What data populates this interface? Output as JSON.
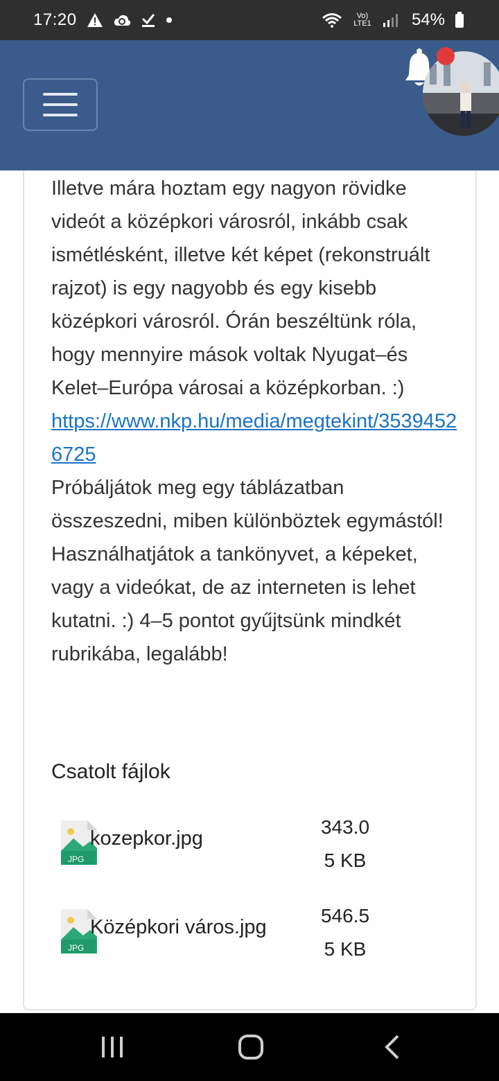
{
  "status_bar": {
    "time": "17:20",
    "left_icons": [
      "warning-icon",
      "cloud-sync-icon",
      "check-download-icon",
      "dot-icon"
    ],
    "network": "Vo) LTE1",
    "battery": "54%"
  },
  "app_header": {
    "menu_icon": "hamburger-icon",
    "notification_icon": "bell-icon",
    "profile_picture": "user-avatar"
  },
  "post": {
    "text_1": "Illetve mára hoztam egy nagyon rövidke videót a középkori városról, inkább csak ismétlésként, illetve két képet (rekonstruált rajzot) is egy nagyobb és egy kisebb középkori városról. Órán beszéltünk róla, hogy mennyire mások voltak Nyugat–és Kelet–Európa városai a középkorban. :)",
    "link": "https://www.nkp.hu/media/megtekint/35394526725",
    "text_2": "Próbáljátok meg egy táblázatban összeszedni, miben különböztek egymástól! Használhatjátok a tankönyvet, a képeket, vagy a videókat, de az interneten is lehet kutatni. :) 4–5 pontot gyűjtsünk mindkét rubrikába, legalább!"
  },
  "attachments": {
    "title": "Csatolt fájlok",
    "files": [
      {
        "name": "kozepkor.jpg",
        "size_line1": "343.0",
        "size_line2": "5 KB",
        "icon": "jpg-file-icon"
      },
      {
        "name": "Középkori város.jpg",
        "size_line1": "546.5",
        "size_line2": "5 KB",
        "icon": "jpg-file-icon"
      }
    ]
  },
  "colors": {
    "header_bg": "#3b5c8a",
    "status_bg": "#2f2f2f",
    "link": "#1a73c7",
    "jpg_icon": "#2aa877"
  }
}
